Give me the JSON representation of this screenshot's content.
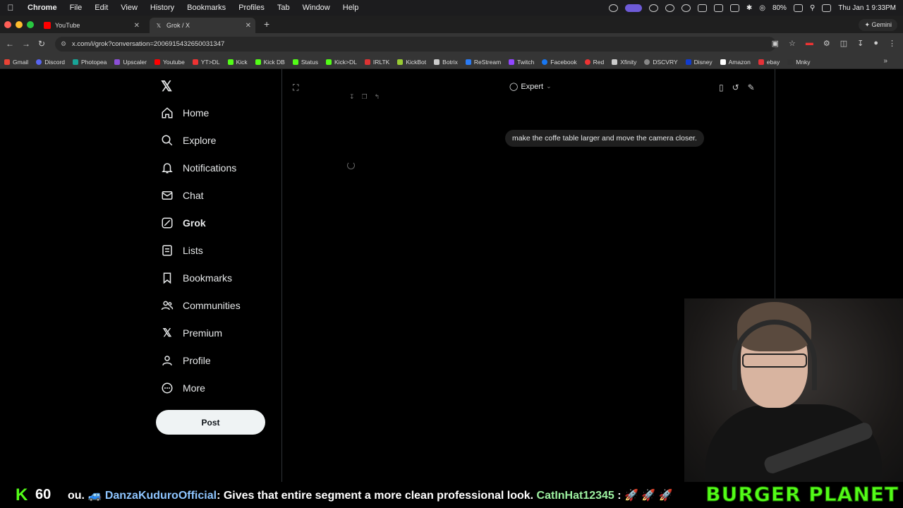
{
  "menubar": {
    "app": "Chrome",
    "items": [
      "File",
      "Edit",
      "View",
      "History",
      "Bookmarks",
      "Profiles",
      "Tab",
      "Window",
      "Help"
    ],
    "battery": "80%",
    "clock": "Thu Jan 1  9:33PM"
  },
  "tabs": [
    {
      "title": "YouTube",
      "favicon": "youtube-icon"
    },
    {
      "title": "Grok / X",
      "favicon": "x-icon"
    }
  ],
  "gemini_label": "Gemini",
  "address": {
    "url": "x.com/i/grok?conversation=2006915432650031347"
  },
  "bookmarks": [
    "Gmail",
    "Discord",
    "Photopea",
    "Upscaler",
    "Youtube",
    "YT>DL",
    "Kick",
    "Kick DB",
    "Status",
    "Kick>DL",
    "IRLTK",
    "KickBot",
    "Botrix",
    "ReStream",
    "Twitch",
    "Facebook",
    "Red",
    "Xfinity",
    "DSCVRY",
    "Disney",
    "Amazon",
    "ebay",
    "Mnky"
  ],
  "xnav": {
    "items": [
      {
        "label": "Home",
        "icon": "home-icon"
      },
      {
        "label": "Explore",
        "icon": "search-icon"
      },
      {
        "label": "Notifications",
        "icon": "bell-icon"
      },
      {
        "label": "Chat",
        "icon": "mail-icon"
      },
      {
        "label": "Grok",
        "icon": "grok-icon"
      },
      {
        "label": "Lists",
        "icon": "list-icon"
      },
      {
        "label": "Bookmarks",
        "icon": "bookmark-icon"
      },
      {
        "label": "Communities",
        "icon": "people-icon"
      },
      {
        "label": "Premium",
        "icon": "x-icon"
      },
      {
        "label": "Profile",
        "icon": "person-icon"
      },
      {
        "label": "More",
        "icon": "more-icon"
      }
    ],
    "post_label": "Post"
  },
  "grok": {
    "mode": "Expert",
    "user_message": "make the coffe table larger and move the camera closer."
  },
  "stream": {
    "viewers": "60",
    "ticker_prefix": "ou.",
    "ticker_user1": "DanzaKuduroOfficial",
    "ticker_msg1": ": Gives that entire segment a more clean professional look.",
    "ticker_user2": "CatInHat12345",
    "ticker_msg2": ":",
    "overlay_text": "BURGER PLANET"
  },
  "colors": {
    "accent_green": "#53fc18",
    "background": "#000000"
  }
}
